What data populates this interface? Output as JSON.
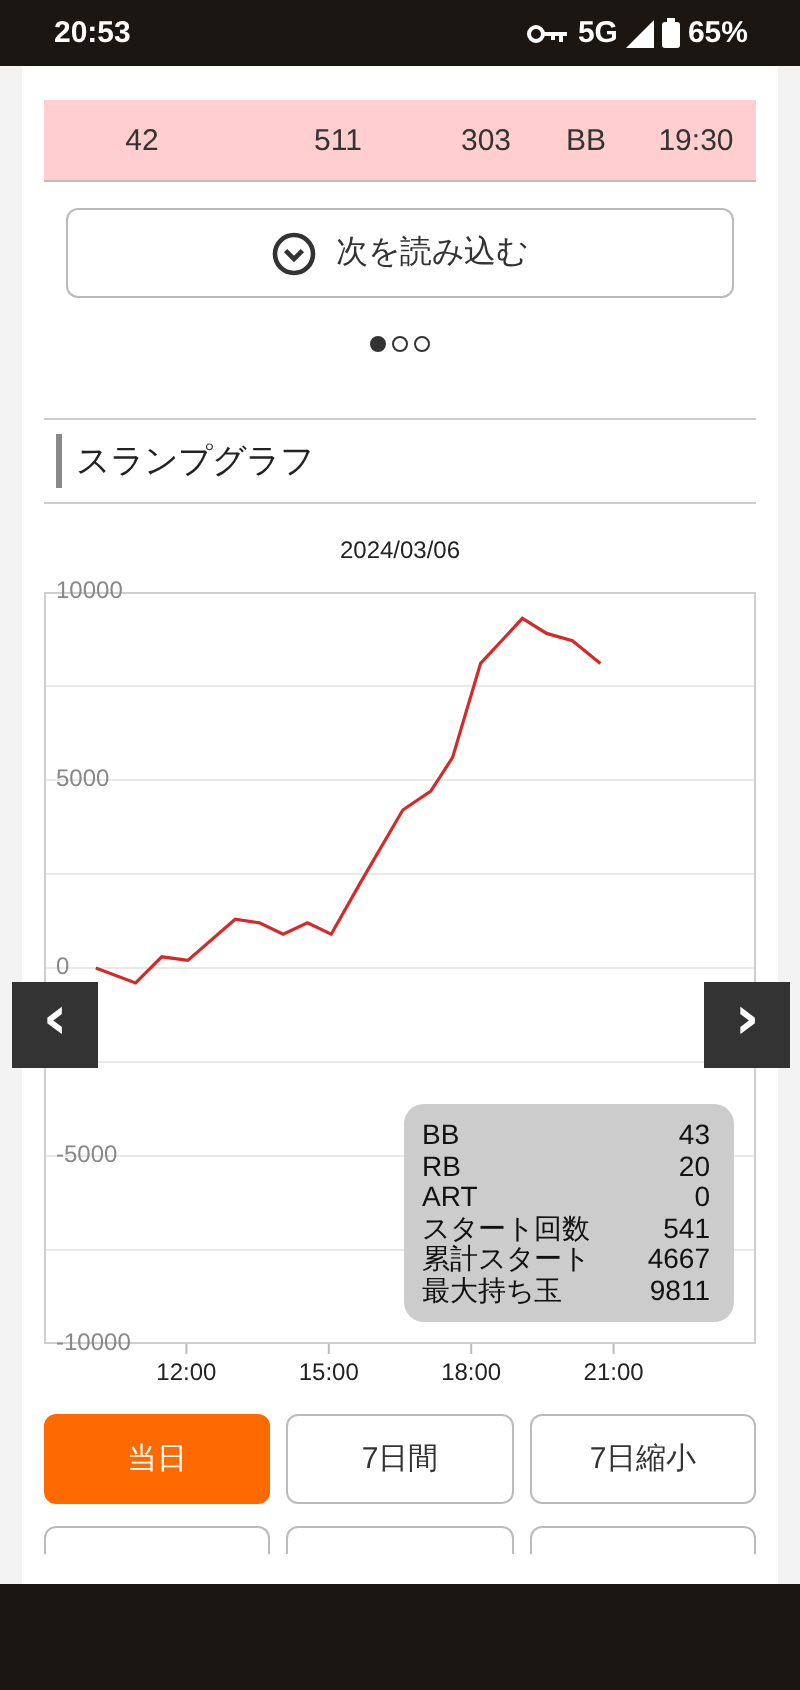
{
  "status_bar": {
    "time": "20:53",
    "network": "5G",
    "battery": "65%"
  },
  "table": {
    "rows": [
      {
        "highlighted": true,
        "cells": [
          "42",
          "511",
          "303",
          "BB",
          "19:30"
        ]
      }
    ]
  },
  "load_more": {
    "label": "次を読み込む"
  },
  "pager": [
    {
      "selected": true
    },
    {
      "selected": false
    },
    {
      "selected": false
    }
  ],
  "section": {
    "title": "スランプグラフ"
  },
  "chart_data": {
    "type": "line",
    "title": "2024/03/06",
    "x": [
      10.09,
      10.93,
      11.48,
      12.03,
      13.03,
      13.54,
      14.04,
      14.55,
      15.05,
      15.68,
      16.56,
      17.15,
      17.61,
      18.2,
      19.08,
      19.59,
      20.13,
      20.72
    ],
    "series": [
      {
        "color": "#d42a2a",
        "values": [
          0,
          -400,
          300,
          200,
          1300,
          1200,
          900,
          1200,
          900,
          2300,
          4200,
          4700,
          5600,
          8100,
          9300,
          8900,
          8700,
          8100
        ]
      }
    ],
    "xlim": [
      9,
      24
    ],
    "ylim": [
      -10000,
      10000
    ],
    "xticks": [
      {
        "value": 12,
        "label": "12:00"
      },
      {
        "value": 15,
        "label": "15:00"
      },
      {
        "value": 18,
        "label": "18:00"
      },
      {
        "value": 21,
        "label": "21:00"
      }
    ],
    "yticks": [
      10000,
      5000,
      0,
      -5000,
      -10000
    ],
    "grid": true
  },
  "chart_nav": {
    "prev": "‹",
    "next": "›"
  },
  "tooltip": [
    {
      "label": "BB",
      "value": "43"
    },
    {
      "label": "RB",
      "value": "20"
    },
    {
      "label": "ART",
      "value": "0"
    },
    {
      "label": "スタート回数",
      "value": "541"
    },
    {
      "label": "累計スタート",
      "value": "4667"
    },
    {
      "label": "最大持ち玉",
      "value": "9811"
    }
  ],
  "range_buttons": [
    {
      "label": "当日",
      "selected": true
    },
    {
      "label": "7日間",
      "selected": false
    },
    {
      "label": "7日縮小",
      "selected": false
    }
  ],
  "more_buttons": [
    {
      "selected": false
    },
    {
      "selected": false
    },
    {
      "selected": false
    }
  ]
}
